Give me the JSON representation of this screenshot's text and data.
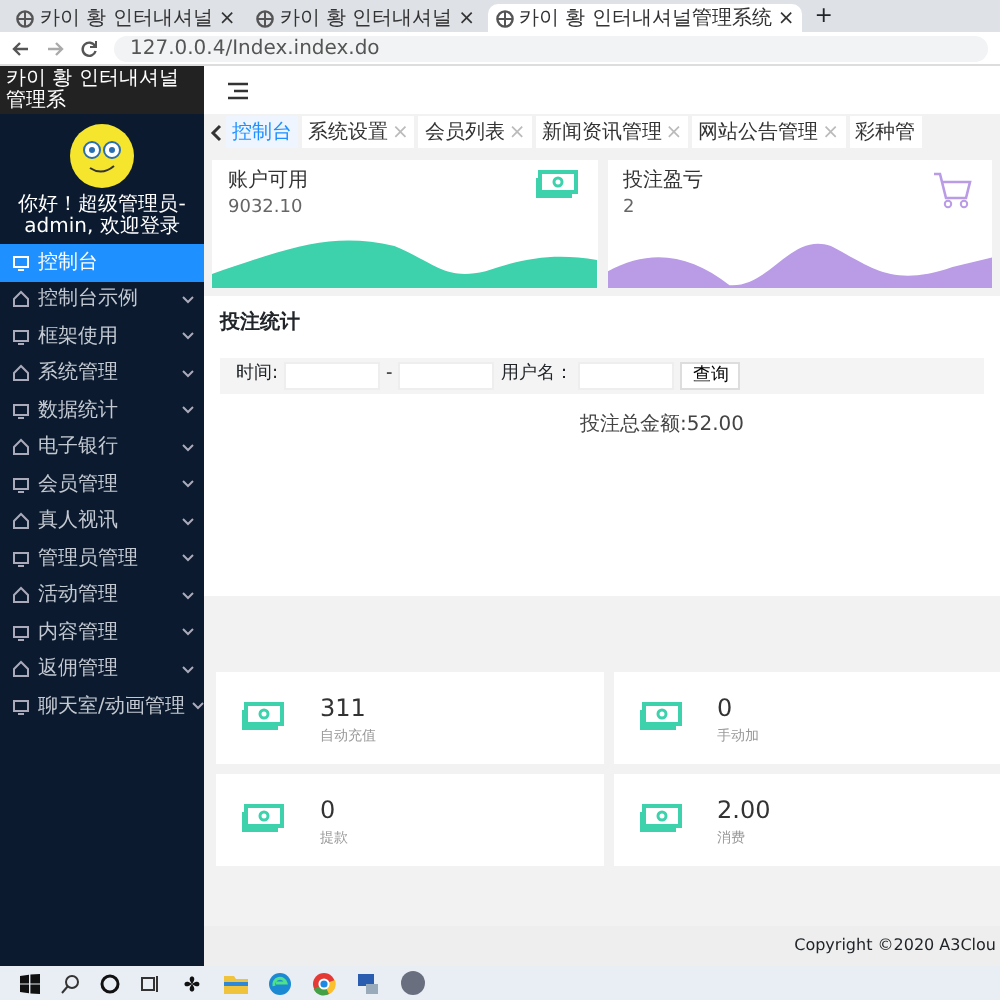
{
  "browser": {
    "tabs": [
      {
        "title": "카이 황 인터내셔널",
        "selected": false
      },
      {
        "title": "카이 황 인터내셔널",
        "selected": false
      },
      {
        "title": "카이 황 인터내셔널管理系统",
        "selected": true
      }
    ],
    "close_mark": "×",
    "new_tab": "+",
    "address": "127.0.0.4/Index.index.do"
  },
  "sidebar": {
    "title": "카이 황 인터내셔널管理系",
    "greeting": "你好！超级管理员-admin, 欢迎登录",
    "items": [
      {
        "label": "控制台",
        "selected": true,
        "expandable": false
      },
      {
        "label": "控制台示例",
        "selected": false,
        "expandable": true
      },
      {
        "label": "框架使用",
        "selected": false,
        "expandable": true
      },
      {
        "label": "系统管理",
        "selected": false,
        "expandable": true
      },
      {
        "label": "数据统计",
        "selected": false,
        "expandable": true
      },
      {
        "label": "电子银行",
        "selected": false,
        "expandable": true
      },
      {
        "label": "会员管理",
        "selected": false,
        "expandable": true
      },
      {
        "label": "真人视讯",
        "selected": false,
        "expandable": true
      },
      {
        "label": "管理员管理",
        "selected": false,
        "expandable": true
      },
      {
        "label": "活动管理",
        "selected": false,
        "expandable": true
      },
      {
        "label": "内容管理",
        "selected": false,
        "expandable": true
      },
      {
        "label": "返佣管理",
        "selected": false,
        "expandable": true
      },
      {
        "label": "聊天室/动画管理",
        "selected": false,
        "expandable": true
      }
    ]
  },
  "page_tabs": [
    {
      "label": "控制台",
      "selected": true,
      "closable": false
    },
    {
      "label": "系统设置",
      "selected": false,
      "closable": true
    },
    {
      "label": "会员列表",
      "selected": false,
      "closable": true
    },
    {
      "label": "新闻资讯管理",
      "selected": false,
      "closable": true
    },
    {
      "label": "网站公告管理",
      "selected": false,
      "closable": true
    },
    {
      "label": "彩种管",
      "selected": false,
      "closable": false
    }
  ],
  "summary_cards": [
    {
      "title": "账户可用",
      "value": "9032.10",
      "kind": "money",
      "color": "#3dd1ac"
    },
    {
      "title": "投注盈亏",
      "value": "2",
      "kind": "cart",
      "color": "#b99be6"
    }
  ],
  "bet_stats": {
    "title": "投注统计",
    "time_label": "时间:",
    "separator": "-",
    "user_label": "用户名：",
    "query_button": "查询",
    "total": "投注总金额:52.00"
  },
  "stat_tiles": [
    {
      "value": "311",
      "label": "自动充值"
    },
    {
      "value": "0",
      "label": "手动加"
    },
    {
      "value": "0",
      "label": "提款"
    },
    {
      "value": "2.00",
      "label": "消费"
    }
  ],
  "footer": "Copyright ©2020 A3Clou"
}
